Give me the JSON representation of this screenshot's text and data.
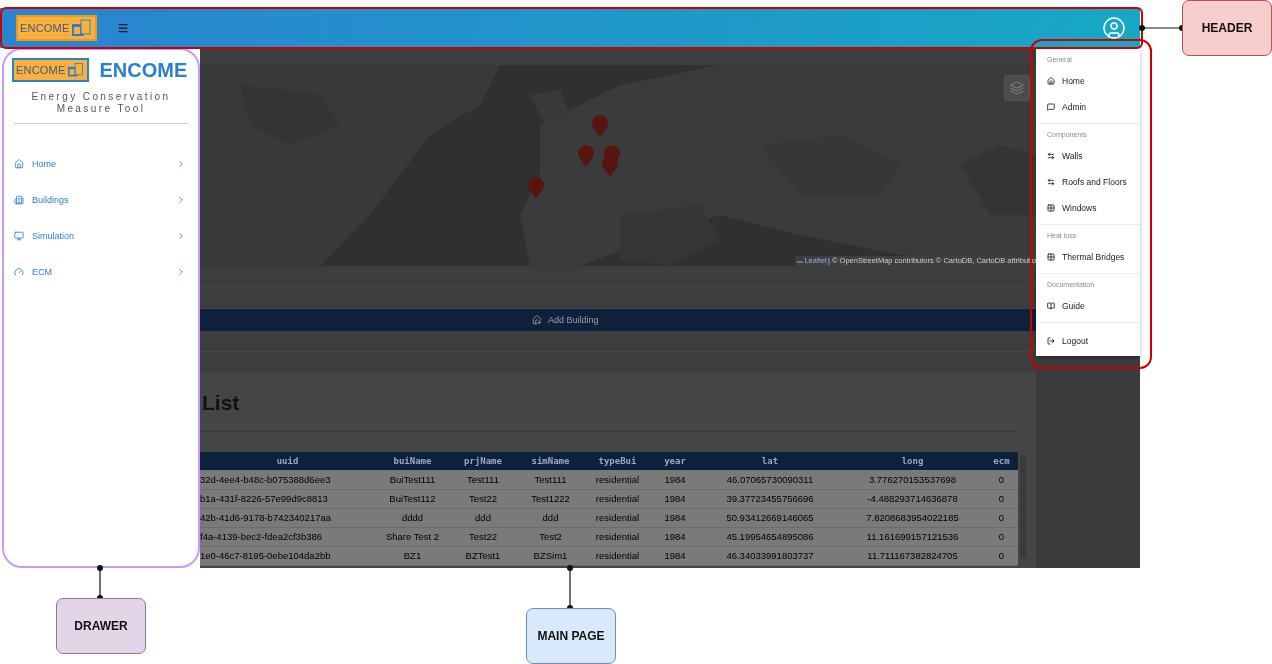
{
  "header": {
    "logo_text": "ENCOME"
  },
  "drawer": {
    "logo_text": "ENCOME",
    "brand": "ENCOME",
    "subtitle": "Energy Conservation Measure Tool",
    "items": [
      {
        "label": "Home"
      },
      {
        "label": "Buildings"
      },
      {
        "label": "Simulation"
      },
      {
        "label": "ECM"
      }
    ]
  },
  "main": {
    "map_attribution": {
      "leaflet": "Leaflet",
      "text": " | © OpenStreetMap contributors © CartoDB, CartoDB attributio"
    },
    "add_button": "Add Building",
    "title": "List",
    "table": {
      "columns": [
        "uuid",
        "buiName",
        "prjName",
        "simName",
        "typeBui",
        "year",
        "lat",
        "long",
        "ecm"
      ],
      "rows": [
        [
          "32d-4ee4-b48c-b075388d6ee3",
          "BuiTest111",
          "Test111",
          "Test111",
          "residential",
          "1984",
          "46.07065730090311",
          "3.776270153537698",
          "0"
        ],
        [
          "b1a-431f-8226-57e99d9c8813",
          "BuiTest112",
          "Test22",
          "Test1222",
          "residential",
          "1984",
          "39.37723455756696",
          "-4.488293714636878",
          "0"
        ],
        [
          "42b-41d6-9178-b742340217aa",
          "dddd",
          "ddd",
          "ddd",
          "residential",
          "1984",
          "50.93412669146065",
          "7.8208683954022185",
          "0"
        ],
        [
          "f4a-4139-bec2-fdea2cf3b386",
          "Share Test 2",
          "Test22",
          "Test2",
          "residential",
          "1984",
          "45.19954654895086",
          "11.161699157121536",
          "0"
        ],
        [
          "1e0-46c7-8195-0ebe104da2bb",
          "BZ1",
          "BZTest1",
          "BZSim1",
          "residential",
          "1984",
          "46.34033991803737",
          "11.711167382824705",
          "0"
        ]
      ]
    }
  },
  "user_menu": {
    "sections": [
      {
        "title": "General",
        "items": [
          "Home",
          "Admin"
        ]
      },
      {
        "title": "Components",
        "items": [
          "Walls",
          "Roofs and Floors",
          "Windows"
        ]
      },
      {
        "title": "Heat loss",
        "items": [
          "Thermal Bridges"
        ]
      },
      {
        "title": "Documentation",
        "items": [
          "Guide"
        ]
      }
    ],
    "logout": "Logout"
  },
  "annotations": [
    {
      "label": "HEADER",
      "color": "#f8cecc"
    },
    {
      "label": "DRAWER",
      "color": "#e1d5e7"
    },
    {
      "label": "MAIN PAGE",
      "color": "#dae8fc"
    }
  ]
}
